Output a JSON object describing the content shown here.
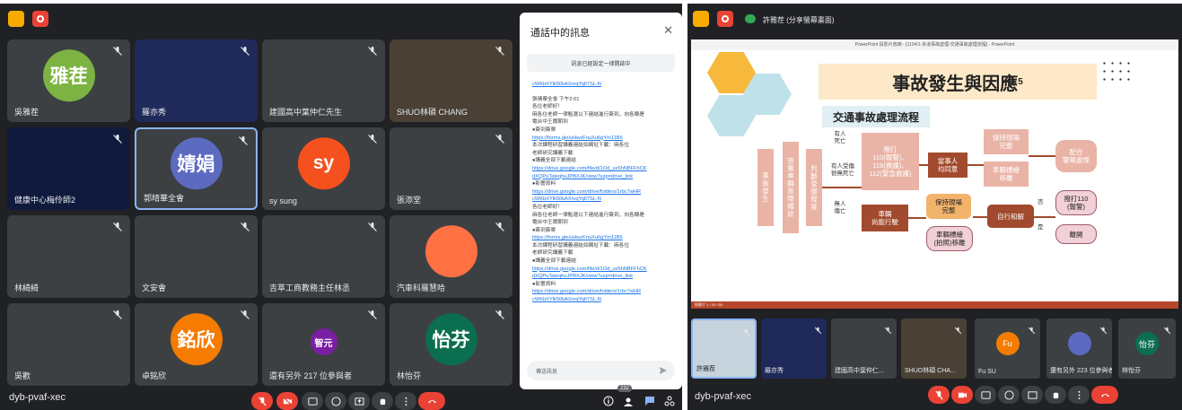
{
  "left": {
    "tiles": [
      {
        "name": "吳雅茬",
        "avatar": "雅茬",
        "color": "#7cb342"
      },
      {
        "name": "羅亦秀",
        "avatar": "",
        "color": ""
      },
      {
        "name": "建國高中葉仲仁先生",
        "avatar": "",
        "color": ""
      },
      {
        "name": "SHUO林碩 CHANG",
        "avatar": "",
        "color": ""
      },
      {
        "name": "健康中心梅伶師2",
        "avatar": "",
        "color": ""
      },
      {
        "name": "郭晴華全會",
        "avatar": "婧娟",
        "color": "#5c6bc0"
      },
      {
        "name": "sy sung",
        "avatar": "sy",
        "color": "#f4511e"
      },
      {
        "name": "張添堂",
        "avatar": "",
        "color": ""
      },
      {
        "name": "林綺綺",
        "avatar": "",
        "color": ""
      },
      {
        "name": "文安會",
        "avatar": "",
        "color": ""
      },
      {
        "name": "吉萃工商教務主任林丞",
        "avatar": "",
        "color": ""
      },
      {
        "name": "汽車科羅慧哈",
        "avatar": "",
        "color": "#ff7043"
      },
      {
        "name": "吳歡",
        "avatar": "",
        "color": ""
      },
      {
        "name": "卓銘欣",
        "avatar": "銘欣",
        "color": "#f57c00"
      },
      {
        "name": "還有另外 217 位參與者",
        "avatar": "智元",
        "color": "#7b1fa2"
      },
      {
        "name": "林怡芬",
        "avatar": "怡芬",
        "color": "#0b6e4f"
      }
    ],
    "meeting_code": "dyb-pvaf-xec",
    "people_count": "232"
  },
  "chat": {
    "title": "通話中的訊息",
    "toggle_label": "訊息已經設定一律開啟中",
    "input_placeholder": "傳送訊息",
    "lines": [
      {
        "text": "cWKbXYlk50kAXrvqYqlI7SL-N",
        "link": true
      },
      {
        "text": "",
        "link": false
      },
      {
        "text": "張晴華全會 下午2:01",
        "link": false
      },
      {
        "text": "各位老師好！",
        "link": false
      },
      {
        "text": "麻各位老師一律點選以下連結進行簽到，向各縣是",
        "link": false
      },
      {
        "text": "電台中王爾朝到",
        "link": false
      },
      {
        "text": "●簽到簽單",
        "link": false
      },
      {
        "text": "https://forms.gle/uHwzFnuXu6gYm11B6",
        "link": true
      },
      {
        "text": "本次課程研習講義連結如網址下載：麻各位",
        "link": false
      },
      {
        "text": "老師研究講義下載",
        "link": false
      },
      {
        "text": "●講義全部下載連結",
        "link": false
      },
      {
        "text": "https://drive.google.com/file/d/1Od_ux5hNBFFhCK",
        "link": true
      },
      {
        "text": "dXQPuTateqhuJPBXJK/view?usp=drive_link",
        "link": true
      },
      {
        "text": "●影響資料",
        "link": false
      },
      {
        "text": "https://drive.google.com/drive/folders/1rbc7wHR",
        "link": true
      },
      {
        "text": "cWKbXYlk50kAXrvqYqlI7SL-N",
        "link": true
      },
      {
        "text": "各位老師好！",
        "link": false
      },
      {
        "text": "麻各位老師一律點選以下連結進行簽到，向各縣是",
        "link": false
      },
      {
        "text": "電台中王爾朝到",
        "link": false
      },
      {
        "text": "●簽到簽單",
        "link": false
      },
      {
        "text": "https://forms.gle/uHwzFnuXu6gYm11B6",
        "link": true
      },
      {
        "text": "本次課程研習講義連結如網址下載：麻各位",
        "link": false
      },
      {
        "text": "老師研究講義下載",
        "link": false
      },
      {
        "text": "●講義全部下載連結",
        "link": false
      },
      {
        "text": "https://drive.google.com/file/d/1Od_ux5hNBFFhCK",
        "link": true
      },
      {
        "text": "dXQPuTateqhuJPBXJK/view?usp=drive_link",
        "link": true
      },
      {
        "text": "●影響資料",
        "link": false
      },
      {
        "text": "https://drive.google.com/drive/folders/1rbc7wHR",
        "link": true
      },
      {
        "text": "cWKbXYlk50kAXrvqYqlI7SL-N",
        "link": true
      }
    ]
  },
  "right": {
    "presenter_label": "許雅茬 (分享螢幕畫面)",
    "window_title": "PowerPoint 投影片放映 - [1134/1-多道事故處理-交通事故處理流程] - PowerPoint",
    "status_text": "投影片 1 / 42 / 50",
    "meeting_code": "dyb-pvaf-xec",
    "slide": {
      "title": "事故發生與因應",
      "title_sup": "5",
      "subtitle": "交通事故處理流程",
      "box_accident": "事故發生",
      "box_remove": "放置車輛故障標誌",
      "box_judge": "判斷受傷程度",
      "label_death": "有人\n死亡",
      "label_injured": "有人受傷\n很無死亡",
      "label_nodeath": "無人\n傷亡",
      "box_call": "撥打\n110(報警)、\n119(救護)、\n112(緊急救護)",
      "box_consent": "當事人\n均同意",
      "box_keep1": "保持現場\n完整",
      "box_mark": "車輛標繪\n移離",
      "box_cooperate": "配合\n警察處理",
      "box_canmove": "車輛\n尚能行駛",
      "box_keep2": "保持現場\n完整",
      "box_photo": "車輛標繪\n(拍照)移離",
      "box_settle": "自行和解",
      "box_call110": "撥打110\n(報警)",
      "box_leave": "離開",
      "label_no": "否",
      "label_yes": "是"
    },
    "film": [
      {
        "name": "許雅茬",
        "avatar": "",
        "color": ""
      },
      {
        "name": "羅亦秀",
        "avatar": "",
        "color": ""
      },
      {
        "name": "建國高中葉仲仁...",
        "avatar": "",
        "color": ""
      },
      {
        "name": "SHUO林碩 CHA...",
        "avatar": "",
        "color": ""
      },
      {
        "name": "Fu SU",
        "avatar": "Fu",
        "color": "#f57c00"
      },
      {
        "name": "還有另外 223 位參與者",
        "avatar": "",
        "color": "#5c6bc0"
      },
      {
        "name": "林怡芬",
        "avatar": "怡芬",
        "color": "#0b6e4f"
      }
    ]
  }
}
